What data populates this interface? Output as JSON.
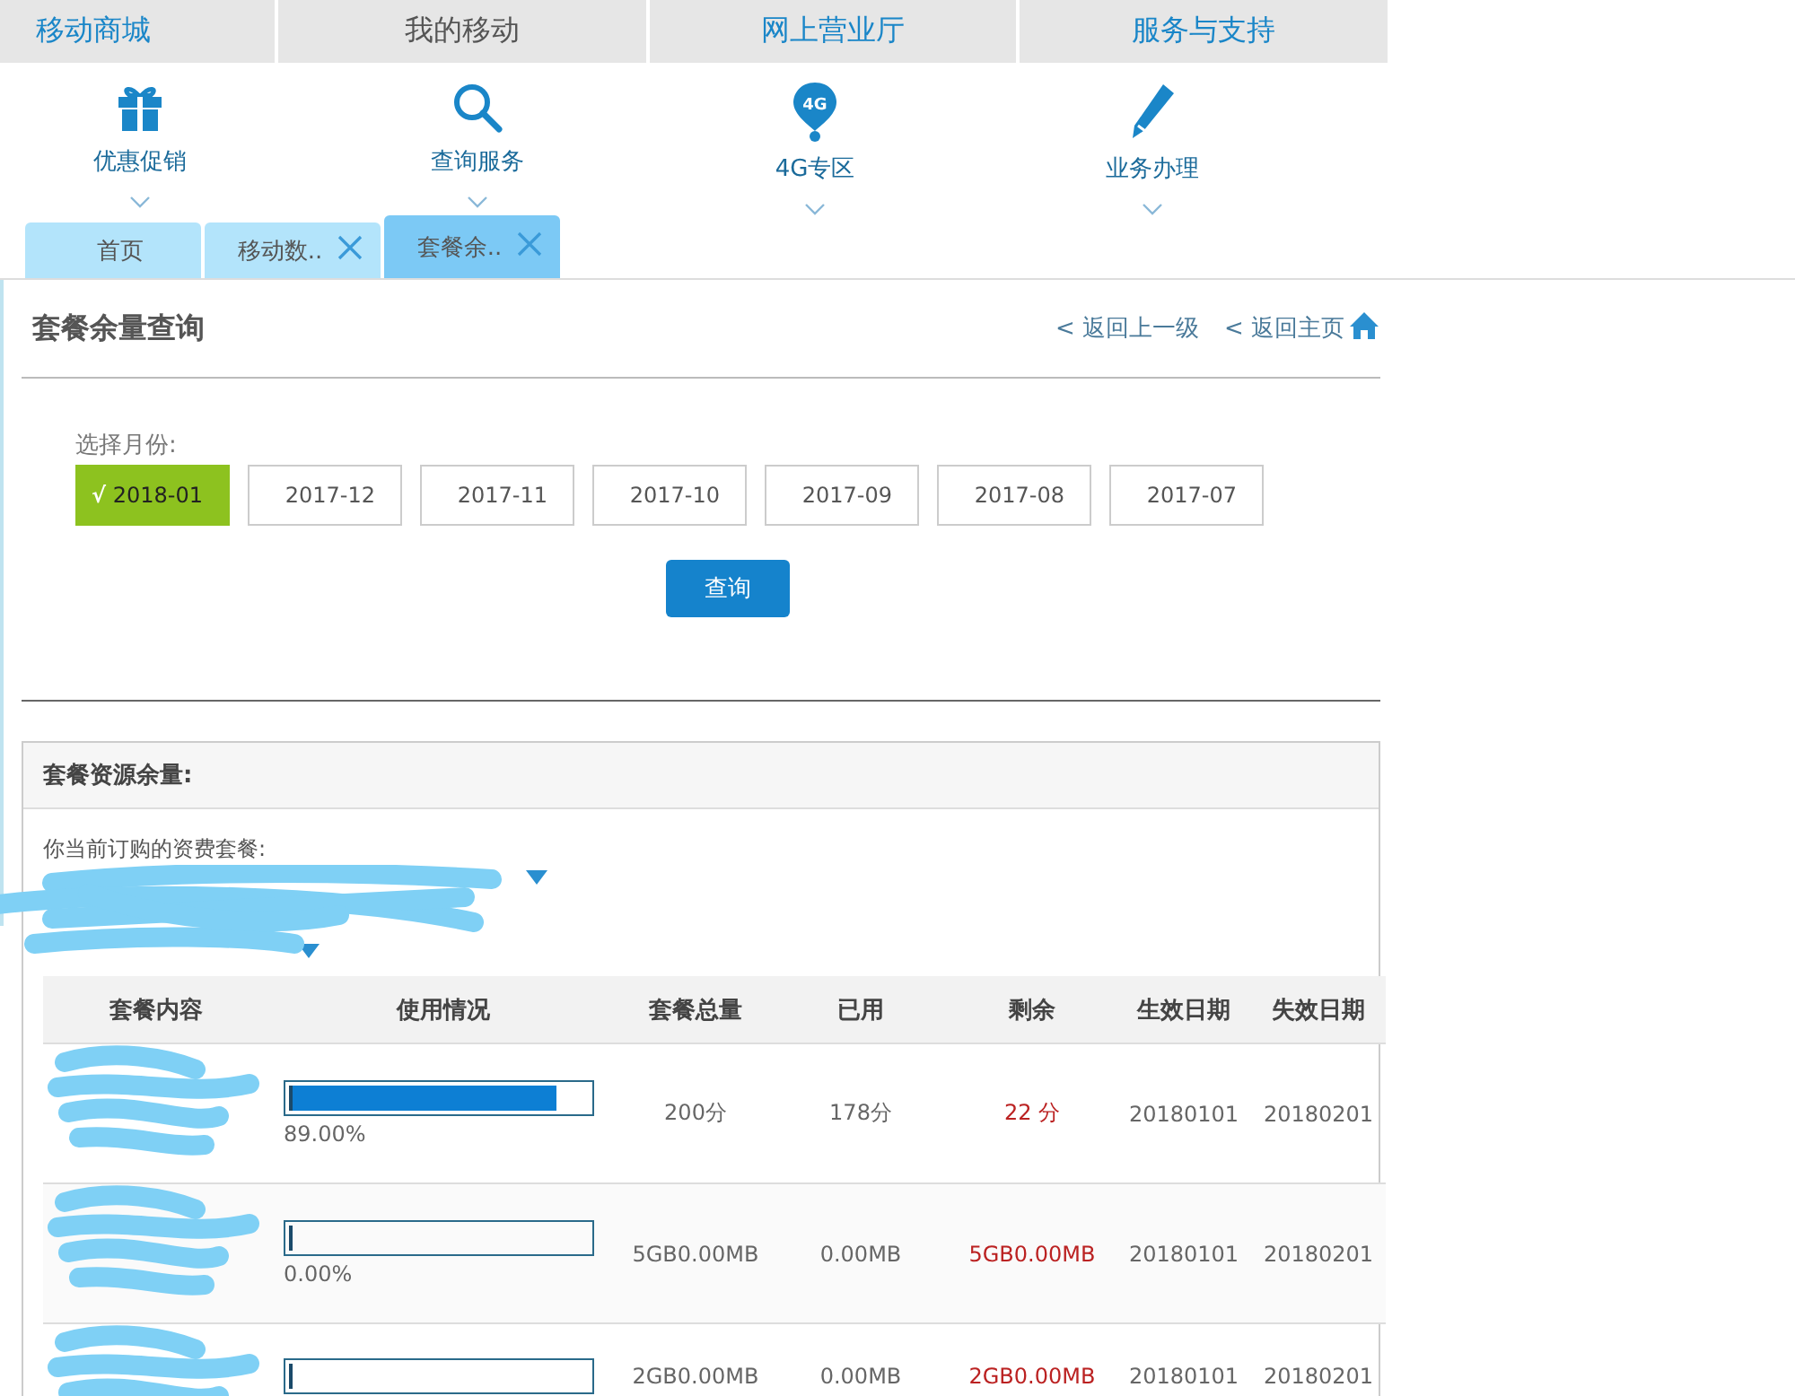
{
  "top_nav": [
    {
      "label": "移动商城",
      "selected": false
    },
    {
      "label": "我的移动",
      "selected": true
    },
    {
      "label": "网上营业厅",
      "selected": false
    },
    {
      "label": "服务与支持",
      "selected": false
    }
  ],
  "quick_nav": [
    {
      "label": "优惠促销",
      "kind": "gift"
    },
    {
      "label": "查询服务",
      "kind": "search"
    },
    {
      "label": "4G专区",
      "kind": "pin",
      "icon_text": "4G"
    },
    {
      "label": "业务办理",
      "kind": "pencil"
    }
  ],
  "tabs": [
    {
      "label": "首页",
      "selected": false,
      "closable": false
    },
    {
      "label": "移动数..",
      "selected": false,
      "closable": true
    },
    {
      "label": "套餐余..",
      "selected": true,
      "closable": true
    }
  ],
  "page_title": "套餐余量查询",
  "back_links": [
    "< 返回上一级",
    "< 返回主页"
  ],
  "month_picker": {
    "label": "选择月份:",
    "check_mark": "√",
    "months": [
      {
        "label": "2018-01",
        "selected": true
      },
      {
        "label": "2017-12",
        "selected": false
      },
      {
        "label": "2017-11",
        "selected": false
      },
      {
        "label": "2017-10",
        "selected": false
      },
      {
        "label": "2017-09",
        "selected": false
      },
      {
        "label": "2017-08",
        "selected": false
      },
      {
        "label": "2017-07",
        "selected": false
      }
    ]
  },
  "query_button": "查询",
  "resources": {
    "title": "套餐资源余量:",
    "plan_label": "你当前订购的资费套餐:",
    "columns": [
      "套餐内容",
      "使用情况",
      "套餐总量",
      "已用",
      "剩余",
      "生效日期",
      "失效日期"
    ],
    "rows": [
      {
        "level": 0.89,
        "percent": "89.00%",
        "total": "200分",
        "used": "178分",
        "remaining": "22 分",
        "start": "20180101",
        "end": "20180201"
      },
      {
        "level": 0,
        "percent": "0.00%",
        "total": "5GB0.00MB",
        "used": "0.00MB",
        "remaining": "5GB0.00MB",
        "start": "20180101",
        "end": "20180201"
      },
      {
        "level": 0,
        "total": "2GB0.00MB",
        "used": "0.00MB",
        "remaining": "2GB0.00MB",
        "start": "20180101",
        "end": "20180201"
      }
    ]
  }
}
